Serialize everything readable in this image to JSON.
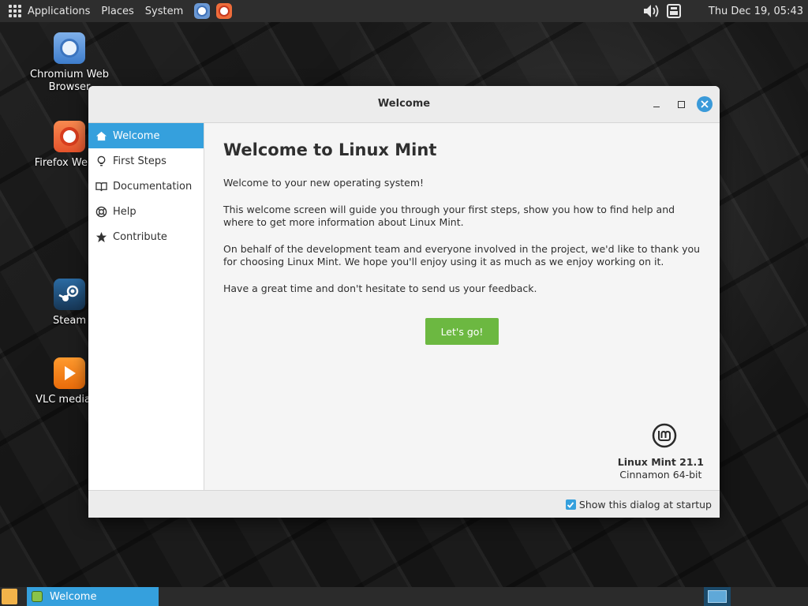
{
  "top_panel": {
    "menus": [
      "Applications",
      "Places",
      "System"
    ],
    "clock": "Thu Dec 19, 05:43"
  },
  "desktop": {
    "icons": [
      {
        "label_line1": "Chromium Web",
        "label_line2": "Browser",
        "icon": "chromium-icon"
      },
      {
        "label_line1": "Firefox Web B",
        "label_line2": "",
        "icon": "firefox-icon"
      },
      {
        "label_line1": "Steam",
        "label_line2": "",
        "icon": "steam-icon"
      },
      {
        "label_line1": "VLC media pl",
        "label_line2": "",
        "icon": "vlc-icon"
      }
    ]
  },
  "window": {
    "title": "Welcome",
    "sidebar": [
      {
        "label": "Welcome",
        "icon": "home-icon",
        "active": true
      },
      {
        "label": "First Steps",
        "icon": "lightbulb-icon",
        "active": false
      },
      {
        "label": "Documentation",
        "icon": "book-icon",
        "active": false
      },
      {
        "label": "Help",
        "icon": "lifebuoy-icon",
        "active": false
      },
      {
        "label": "Contribute",
        "icon": "star-icon",
        "active": false
      }
    ],
    "content": {
      "heading": "Welcome to Linux Mint",
      "paragraphs": [
        "Welcome to your new operating system!",
        "This welcome screen will guide you through your first steps, show you how to find help and where to get more information about Linux Mint.",
        "On behalf of the development team and everyone involved in the project, we'd like to thank you for choosing Linux Mint. We hope you'll enjoy using it as much as we enjoy working on it.",
        "Have a great time and don't hesitate to send us your feedback."
      ],
      "button_label": "Let's go!",
      "version": "Linux Mint 21.1",
      "edition": "Cinnamon 64-bit"
    },
    "footer": {
      "checkbox_label": "Show this dialog at startup",
      "checked": true
    }
  },
  "taskbar": {
    "task_label": "Welcome"
  },
  "colors": {
    "accent": "#35a0dd",
    "go_button": "#6cb841"
  }
}
